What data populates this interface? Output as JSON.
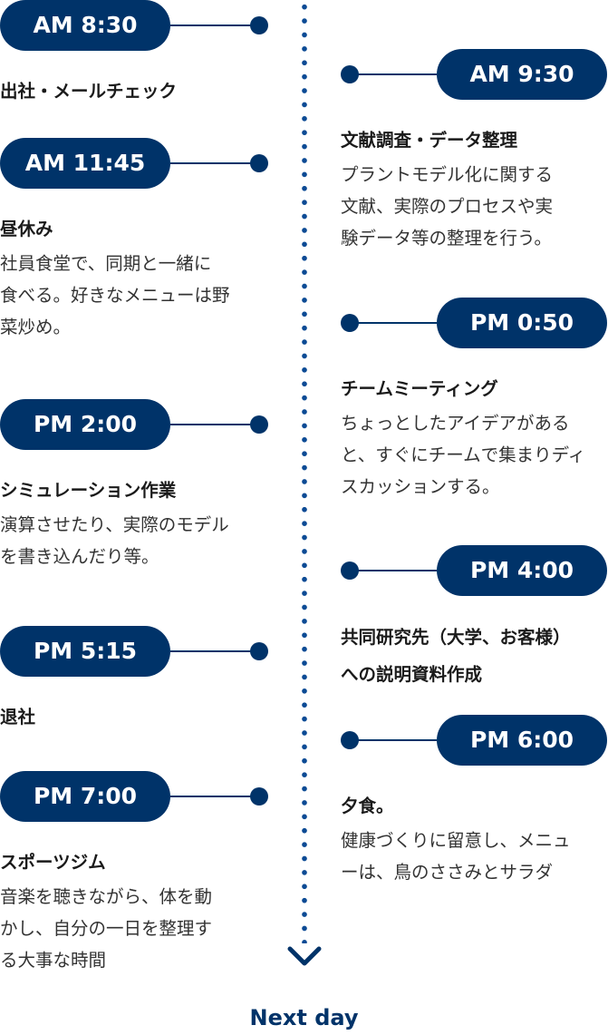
{
  "colors": {
    "accent": "#003369",
    "dots": "#0b4a94"
  },
  "left": [
    {
      "time": "AM 8:30",
      "title": "出社・メールチェック",
      "body": ""
    },
    {
      "time": "AM 11:45",
      "title": "昼休み",
      "body": "社員食堂で、同期と一緒に\n食べる。好きなメニューは野\n菜炒め。"
    },
    {
      "time": "PM 2:00",
      "title": "シミュレーション作業",
      "body": "演算させたり、実際のモデル\nを書き込んだり等。"
    },
    {
      "time": "PM 5:15",
      "title": "退社",
      "body": ""
    },
    {
      "time": "PM 7:00",
      "title": "スポーツジム",
      "body": "音楽を聴きながら、体を動\nかし、自分の一日を整理す\nる大事な時間"
    }
  ],
  "right": [
    {
      "time": "AM 9:30",
      "title": "文献調査・データ整理",
      "body": "プラントモデル化に関する\n文献、実際のプロセスや実\n験データ等の整理を行う。"
    },
    {
      "time": "PM 0:50",
      "title": "チームミーティング",
      "body": "ちょっとしたアイデアがある\nと、すぐにチームで集まりディ\nスカッションする。"
    },
    {
      "time": "PM 4:00",
      "title": "共同研究先（大学、お客様）\nへの説明資料作成",
      "body": ""
    },
    {
      "time": "PM 6:00",
      "title": "夕食。",
      "body": "健康づくりに留意し、メニュ\nーは、鳥のささみとサラダ"
    }
  ],
  "footer": {
    "label": "Next day",
    "icon": "chevron-down-icon"
  }
}
